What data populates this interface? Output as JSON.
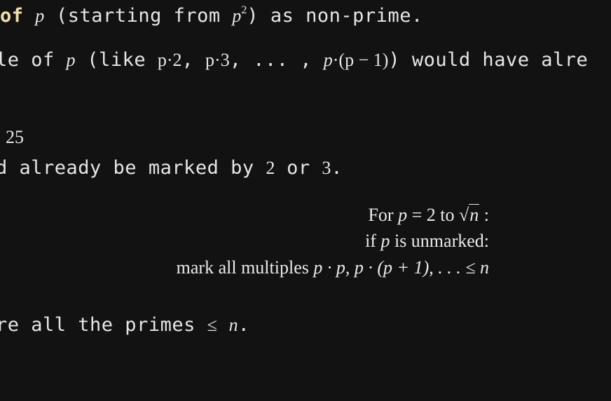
{
  "line1": {
    "bold_start": "of",
    "var_p": "p",
    "text_a": " (starting from ",
    "p_base": "p",
    "p_exp": "2",
    "text_b": ") as non-prime."
  },
  "line2": {
    "text_a": "le of ",
    "var_p": "p",
    "text_b": " (like ",
    "expr1": "p·2",
    "sep1": ", ",
    "expr2": "p·3",
    "sep2": ",  ... , ",
    "expr3_p": "p",
    "expr3_rest": "·(p − 1)",
    "text_c": ") would have alre"
  },
  "line3": {
    "number": "25"
  },
  "line4": {
    "text_a": "d already be marked by ",
    "num_a": "2",
    "text_b": " or ",
    "num_b": "3",
    "text_c": "."
  },
  "algorithm": {
    "line1_for": "For ",
    "line1_p": "p",
    "line1_eq": " = 2 to ",
    "line1_sqrt": "√",
    "line1_n": "n",
    "line1_colon": " :",
    "line2_if": "if ",
    "line2_p": "p",
    "line2_rest": " is unmarked:",
    "line3_text": "mark all multiples ",
    "line3_expr": "p · p, p · (p + 1), . . . ≤ n"
  },
  "line5": {
    "text_a": "re all the primes ",
    "le": "≤",
    "var_n": "n",
    "text_b": "."
  }
}
